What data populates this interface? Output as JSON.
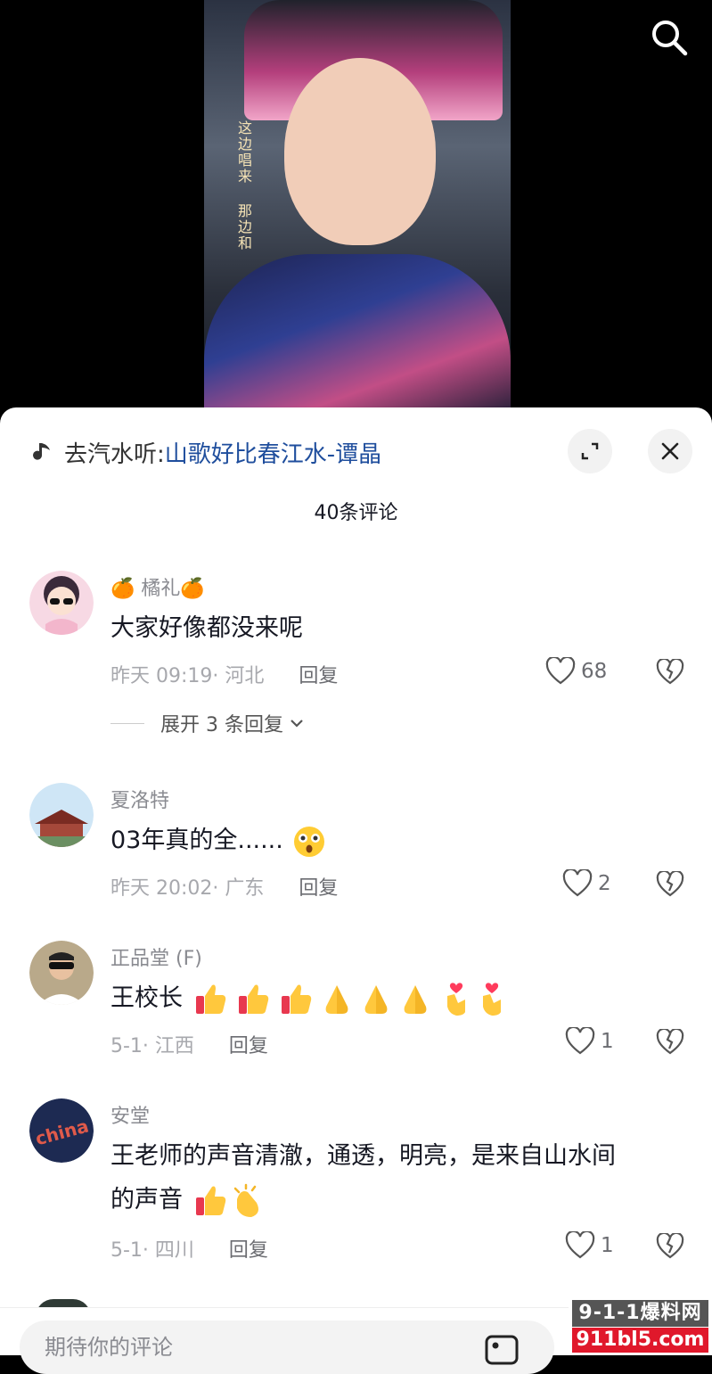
{
  "video": {
    "caption": "这边唱来 那边和"
  },
  "music": {
    "prefix": "去汽水听:",
    "title": "山歌好比春江水-谭晶"
  },
  "comments_header": {
    "count_text": "40条评论"
  },
  "comments": [
    {
      "name": "🍊 橘礼🍊",
      "text": "大家好像都没来呢",
      "time_location": "昨天 09:19· 河北",
      "reply_label": "回复",
      "likes": "68",
      "expand_label": "展开 3 条回复"
    },
    {
      "name": "夏洛特",
      "text": "03年真的全......",
      "time_location": "昨天 20:02· 广东",
      "reply_label": "回复",
      "likes": "2"
    },
    {
      "name": "正品堂 (F)",
      "text": "王校长",
      "time_location": "5-1· 江西",
      "reply_label": "回复",
      "likes": "1"
    },
    {
      "name": "安堂",
      "text_line1": "王老师的声音清澈，通透，明亮，是来自山水间",
      "text_line2": "的声音",
      "time_location": "5-1· 四川",
      "reply_label": "回复",
      "likes": "1"
    }
  ],
  "input": {
    "placeholder": "期待你的评论"
  },
  "watermark": {
    "top": "9-1-1爆料网",
    "bottom": "911bl5.com"
  }
}
